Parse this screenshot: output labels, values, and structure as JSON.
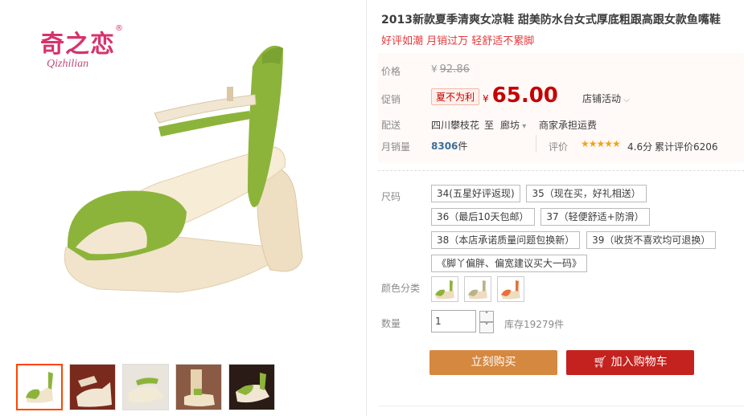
{
  "brand": {
    "name_cn": "奇之恋",
    "reg": "®",
    "name_en": "Qizhilian"
  },
  "product": {
    "title": "2013新款夏季清爽女凉鞋 甜美防水台女式厚底粗跟高跟女款鱼嘴鞋",
    "subtitle": "好评如潮 月销过万 轻舒适不累脚"
  },
  "price": {
    "label": "价格",
    "yen": "¥",
    "original": "92.86"
  },
  "promo": {
    "label": "促销",
    "tag": "夏不为利",
    "yen": "¥",
    "price": "65.00",
    "shop_activity": "店铺活动"
  },
  "shipping": {
    "label": "配送",
    "from": "四川攀枝花",
    "to_word": "至",
    "to": "廊坊",
    "fee": "商家承担运费"
  },
  "sales": {
    "label": "月销量",
    "count": "8306",
    "unit": "件",
    "rating_label": "评价",
    "rating": "4.6分",
    "total_reviews": "累计评价6206"
  },
  "size": {
    "label": "尺码",
    "options": [
      "34(五星好评返现)",
      "35（现在买，好礼相送）",
      "36（最后10天包邮）",
      "37（轻便舒适+防滑）",
      "38（本店承诺质量问题包换新）",
      "39（收货不喜欢均可退换）",
      "《脚丫偏胖、偏宽建议买大一码》"
    ]
  },
  "color": {
    "label": "颜色分类"
  },
  "quantity": {
    "label": "数量",
    "value": "1",
    "up": "˄",
    "down": "˅",
    "stock": "库存19279件"
  },
  "actions": {
    "buy_now": "立刻购买",
    "add_cart": "加入购物车"
  },
  "colors": {
    "accent": "#c40000",
    "buy": "#d5883f",
    "cart": "#c4221e",
    "shoe_green": "#8db43a",
    "sole": "#eedcc0"
  }
}
